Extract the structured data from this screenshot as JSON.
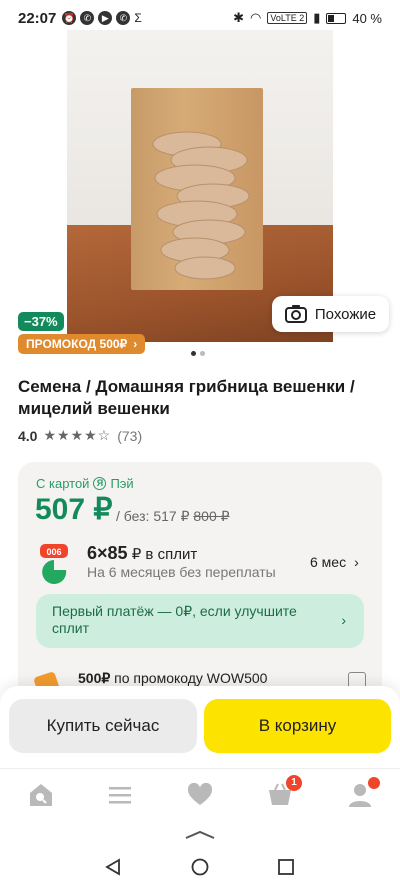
{
  "status_bar": {
    "time": "22:07",
    "battery": "40 %",
    "network": "VoLTE 2"
  },
  "product": {
    "discount": "−37%",
    "promo_badge": "ПРОМОКОД 500₽",
    "similar_label": "Похожие",
    "title": "Семена / Домашняя грибница вешенки / мицелий вешенки",
    "rating_value": "4.0",
    "stars_filled": 4,
    "stars_total": 5,
    "review_count": "(73)"
  },
  "price_card": {
    "card_label": "С картой",
    "pay_brand": "Пэй",
    "price": "507 ₽",
    "price_without_label": "/ без: 517 ₽",
    "old_price": "800 ₽",
    "split_icon_label": "006",
    "split_title_count": "6×85",
    "split_title_rest": "₽ в сплит",
    "split_subtitle": "На 6 месяцев без переплаты",
    "split_months": "6 мес",
    "banner_text": "Первый платёж — 0₽, если улучшите сплит",
    "promo_amount": "500₽",
    "promo_text": "по промокоду WOW500"
  },
  "actions": {
    "buy_now": "Купить сейчас",
    "add_to_cart": "В корзину"
  },
  "bottom_nav": {
    "cart_count": "1"
  },
  "colors": {
    "green": "#138a5c",
    "yellow": "#fde300",
    "orange": "#e08a2e",
    "red": "#f0452a"
  }
}
